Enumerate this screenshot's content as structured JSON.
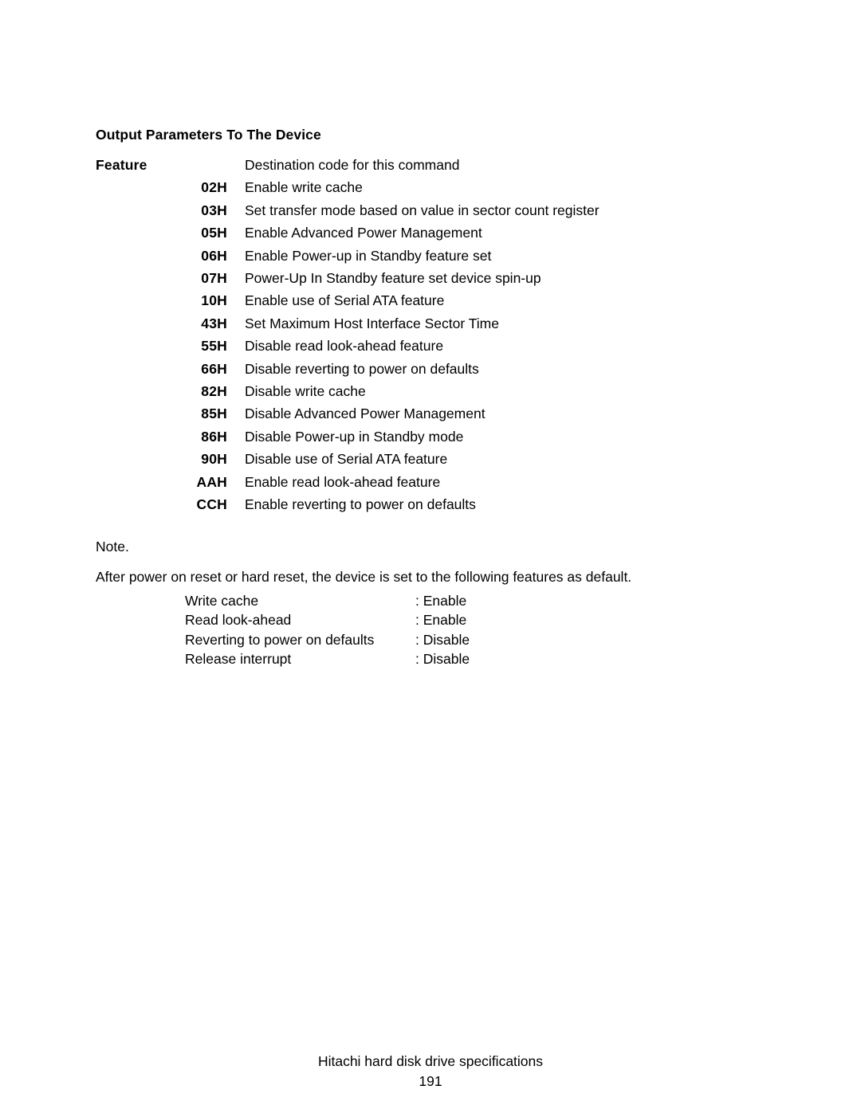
{
  "document": {
    "section_title": "Output Parameters To The Device",
    "feature_label": "Feature",
    "feature_description": "Destination code for this command",
    "codes": [
      {
        "code": "02H",
        "description": "Enable write cache"
      },
      {
        "code": "03H",
        "description": "Set transfer mode based on value in sector count register"
      },
      {
        "code": "05H",
        "description": "Enable Advanced Power Management"
      },
      {
        "code": "06H",
        "description": "Enable Power-up in Standby feature set"
      },
      {
        "code": "07H",
        "description": "Power-Up In Standby feature set device spin-up"
      },
      {
        "code": "10H",
        "description": "Enable use of Serial ATA feature"
      },
      {
        "code": "43H",
        "description": "Set Maximum Host Interface Sector Time"
      },
      {
        "code": "55H",
        "description": "Disable read look-ahead feature"
      },
      {
        "code": "66H",
        "description": "Disable reverting to power on defaults"
      },
      {
        "code": "82H",
        "description": "Disable write cache"
      },
      {
        "code": "85H",
        "description": "Disable Advanced Power Management"
      },
      {
        "code": "86H",
        "description": "Disable Power-up in Standby mode"
      },
      {
        "code": "90H",
        "description": "Disable use of Serial ATA feature"
      },
      {
        "code": "AAH",
        "description": "Enable read look-ahead feature"
      },
      {
        "code": "CCH",
        "description": "Enable reverting to power on defaults"
      }
    ],
    "note": {
      "label": "Note.",
      "text": "After power on reset or hard reset, the device is set to the following features as default.",
      "defaults": [
        {
          "name": "Write cache",
          "value": ": Enable"
        },
        {
          "name": "Read look-ahead",
          "value": ": Enable"
        },
        {
          "name": "Reverting to power on defaults",
          "value": ": Disable"
        },
        {
          "name": "Release interrupt",
          "value": ": Disable"
        }
      ]
    }
  },
  "footer": {
    "title": "Hitachi hard disk drive specifications",
    "page_number": "191"
  }
}
